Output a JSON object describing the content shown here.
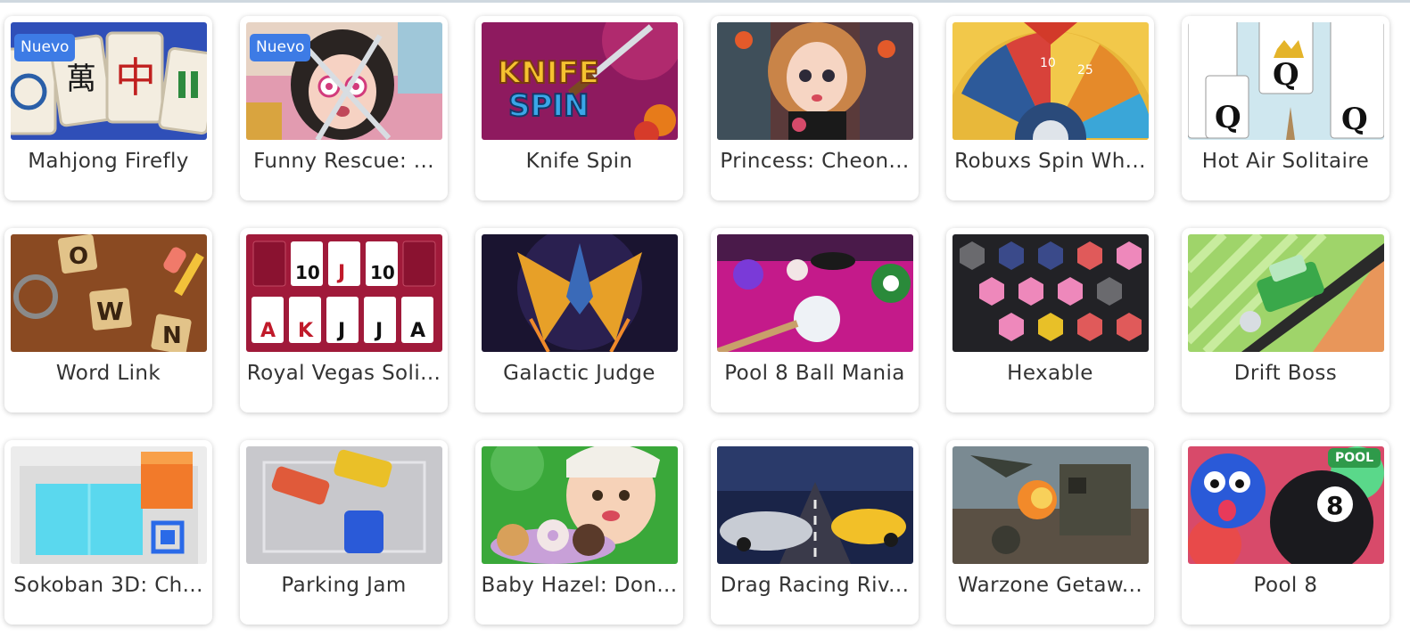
{
  "badge_new": "Nuevo",
  "games": [
    {
      "title": "Mahjong Firefly",
      "badge": "Nuevo",
      "art_text": ""
    },
    {
      "title": "Funny Rescue: ...",
      "badge": "Nuevo",
      "art_text": ""
    },
    {
      "title": "Knife Spin",
      "badge": "",
      "art_text": "KNIFE SPIN"
    },
    {
      "title": "Princess: Cheon...",
      "badge": "",
      "art_text": ""
    },
    {
      "title": "Robuxs Spin Wh...",
      "badge": "",
      "art_text": ""
    },
    {
      "title": "Hot Air Solitaire",
      "badge": "",
      "art_text": ""
    },
    {
      "title": "Word Link",
      "badge": "",
      "art_text": ""
    },
    {
      "title": "Royal Vegas Soli...",
      "badge": "",
      "art_text": ""
    },
    {
      "title": "Galactic Judge",
      "badge": "",
      "art_text": ""
    },
    {
      "title": "Pool 8 Ball Mania",
      "badge": "",
      "art_text": ""
    },
    {
      "title": "Hexable",
      "badge": "",
      "art_text": ""
    },
    {
      "title": "Drift Boss",
      "badge": "",
      "art_text": ""
    },
    {
      "title": "Sokoban 3D: Ch...",
      "badge": "",
      "art_text": ""
    },
    {
      "title": "Parking Jam",
      "badge": "",
      "art_text": ""
    },
    {
      "title": "Baby Hazel: Don...",
      "badge": "",
      "art_text": ""
    },
    {
      "title": "Drag Racing Riv...",
      "badge": "",
      "art_text": ""
    },
    {
      "title": "Warzone Getaw...",
      "badge": "",
      "art_text": ""
    },
    {
      "title": "Pool 8",
      "badge": "POOL",
      "art_text": ""
    }
  ]
}
